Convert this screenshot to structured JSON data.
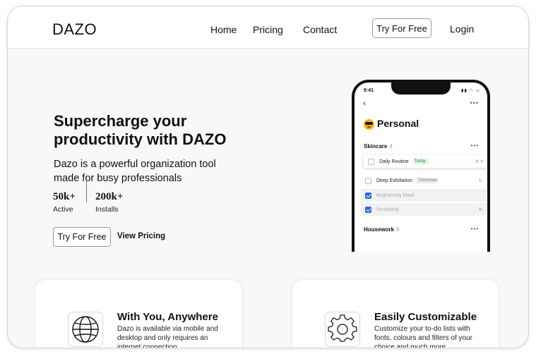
{
  "nav": {
    "logo": "DAZO",
    "links": [
      "Home",
      "Pricing",
      "Contact"
    ],
    "try_label": "Try For Free",
    "login_label": "Login"
  },
  "hero": {
    "title": "Supercharge your productivity with DAZO",
    "subtitle": "Dazo is a powerful organization tool made for busy professionals",
    "stats": [
      {
        "value": "50k+",
        "label": "Active"
      },
      {
        "value": "200k+",
        "label": "Installs"
      }
    ],
    "try_label": "Try For Free",
    "pricing_label": "View Pricing"
  },
  "phone": {
    "time": "9:41",
    "list_title": "Personal",
    "emoji_icon": "sunglasses-emoji-icon",
    "sections": [
      {
        "name": "Skincare",
        "count": "4"
      },
      {
        "name": "Housework",
        "count": "6"
      }
    ],
    "tasks": [
      {
        "label": "Daily Routine",
        "tag": "Today",
        "checked": false
      },
      {
        "label": "Deep Exfoliation",
        "tag": "Tomorrow",
        "checked": false
      },
      {
        "label": "Brightening Mask",
        "tag": "",
        "checked": true
      },
      {
        "label": "Scrubbing",
        "tag": "",
        "checked": true
      }
    ]
  },
  "features": [
    {
      "icon": "globe-icon",
      "title": "With You, Anywhere",
      "text": "Dazo is available via mobile and desktop and only requires an internet connection"
    },
    {
      "icon": "gear-icon",
      "title": "Easily Customizable",
      "text": "Customize your to-do lists with fonts, colours and filters of your choice and much more"
    }
  ],
  "colors": {
    "checkbox_blue": "#2f6bd8",
    "today_green": "#2f8a45",
    "emoji_yellow": "#f5b301"
  }
}
